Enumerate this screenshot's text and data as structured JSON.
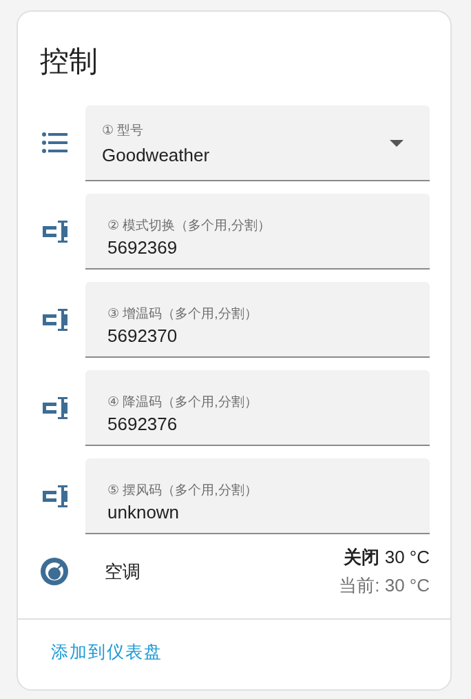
{
  "card": {
    "title": "控制",
    "fields": [
      {
        "kind": "select",
        "label": "① 型号",
        "value": "Goodweather"
      },
      {
        "kind": "text",
        "label": "② 模式切换（多个用,分割）",
        "value": "5692369"
      },
      {
        "kind": "text",
        "label": "③ 增温码（多个用,分割）",
        "value": "5692370"
      },
      {
        "kind": "text",
        "label": "④ 降温码（多个用,分割）",
        "value": "5692376"
      },
      {
        "kind": "text",
        "label": "⑤ 摆风码（多个用,分割）",
        "value": "unknown"
      }
    ],
    "climate": {
      "name": "空调",
      "state": "关闭",
      "target": "30 °C",
      "current": "当前: 30 °C"
    },
    "footer_link": "添加到仪表盘"
  }
}
